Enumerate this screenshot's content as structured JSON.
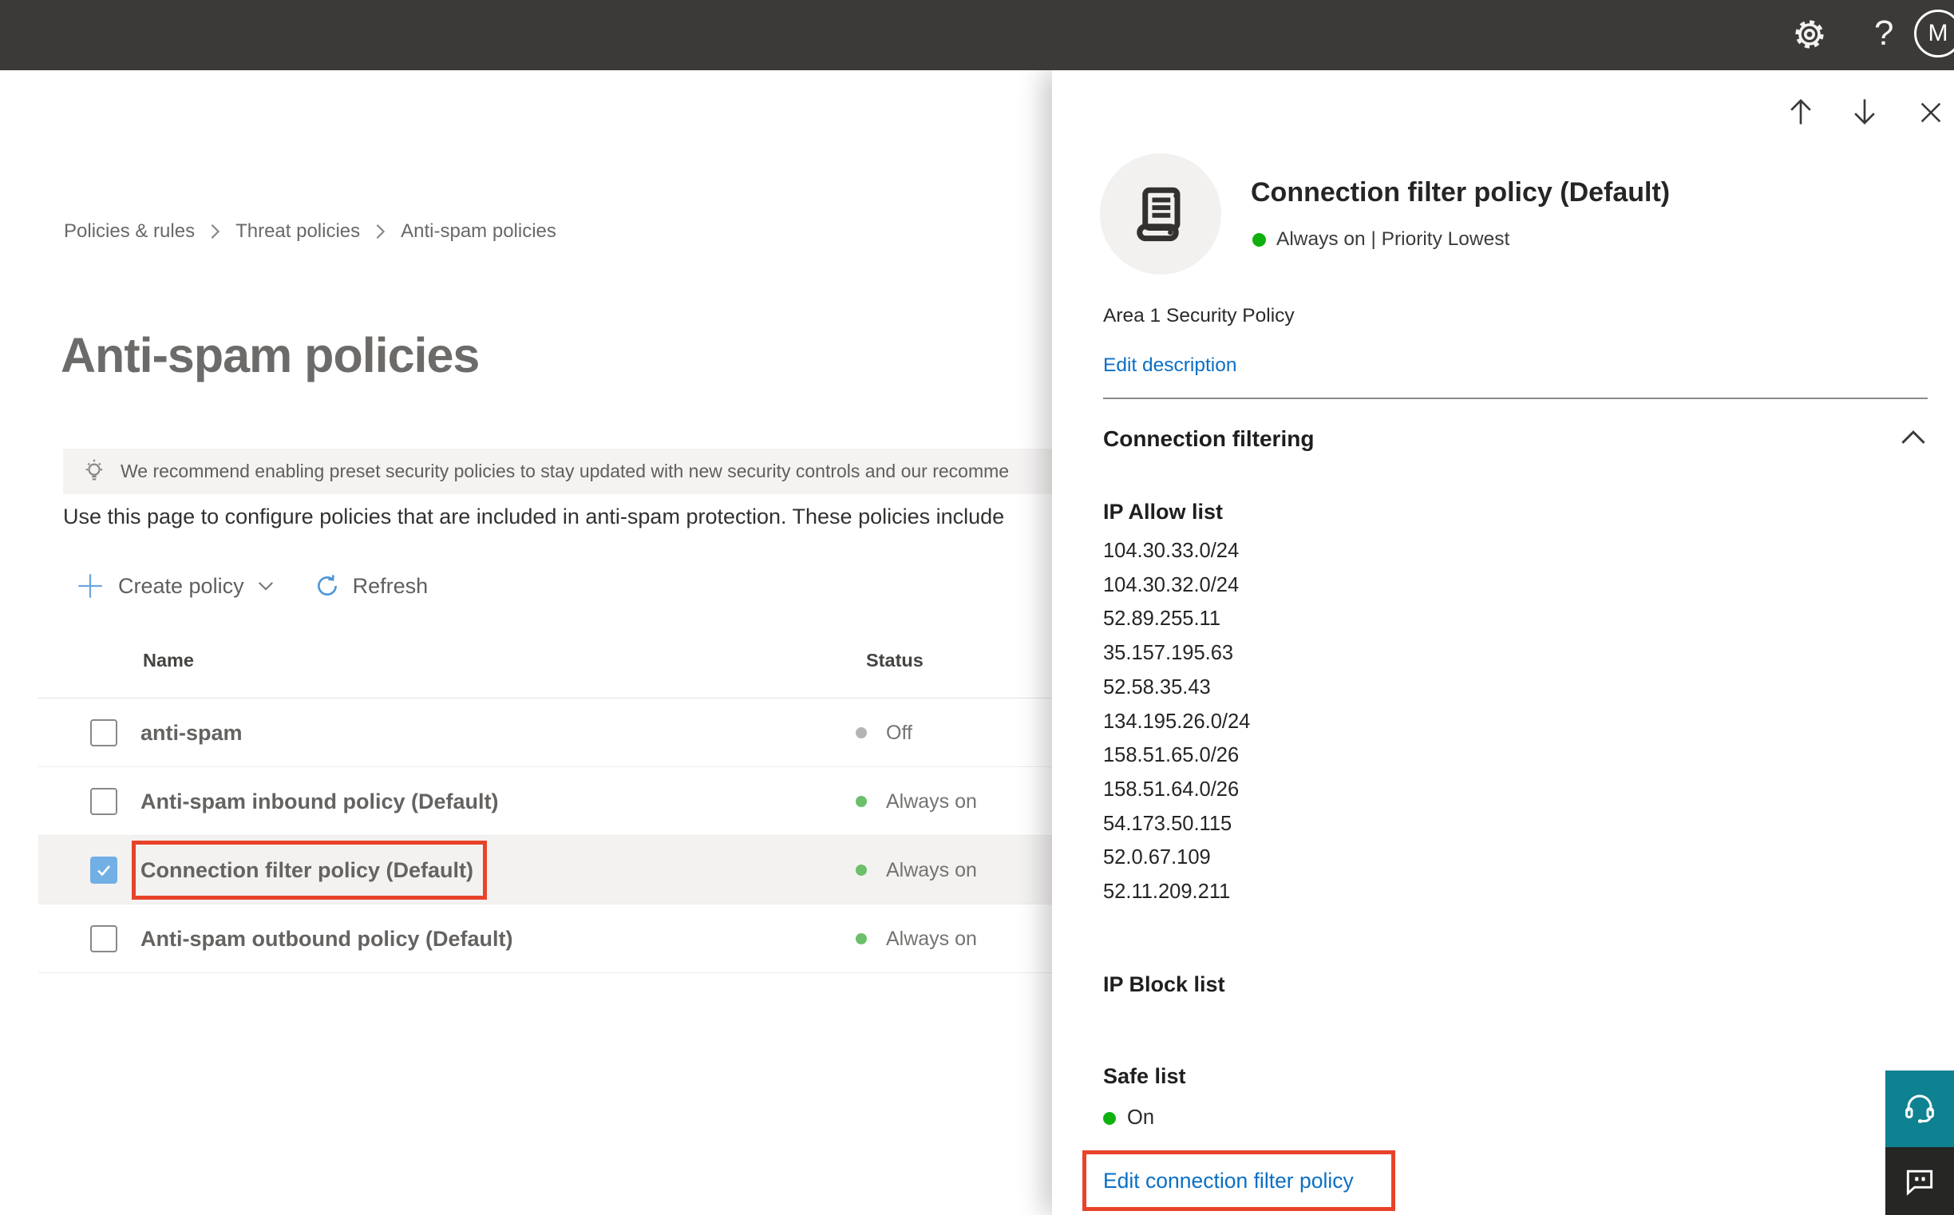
{
  "topbar": {
    "help_label": "?",
    "avatar_initial": "M"
  },
  "breadcrumb": {
    "items": [
      "Policies & rules",
      "Threat policies",
      "Anti-spam policies"
    ]
  },
  "main": {
    "title": "Anti-spam policies",
    "banner_text": "We recommend enabling preset security policies to stay updated with new security controls and our recomme",
    "description": "Use this page to configure policies that are included in anti-spam protection. These policies include",
    "toolbar": {
      "create_policy_label": "Create policy",
      "refresh_label": "Refresh"
    }
  },
  "table": {
    "columns": {
      "name": "Name",
      "status": "Status"
    },
    "rows": [
      {
        "name": "anti-spam",
        "status": "Off",
        "checked": false,
        "selected": false
      },
      {
        "name": "Anti-spam inbound policy (Default)",
        "status": "Always on",
        "checked": false,
        "selected": false
      },
      {
        "name": "Connection filter policy (Default)",
        "status": "Always on",
        "checked": true,
        "selected": true
      },
      {
        "name": "Anti-spam outbound policy (Default)",
        "status": "Always on",
        "checked": false,
        "selected": false
      }
    ]
  },
  "panel": {
    "title": "Connection filter policy (Default)",
    "status_line": "Always on | Priority Lowest",
    "description": "Area 1 Security Policy",
    "edit_description_label": "Edit description",
    "section_title": "Connection filtering",
    "ip_allow": {
      "heading": "IP Allow list",
      "ips": [
        "104.30.33.0/24",
        "104.30.32.0/24",
        "52.89.255.11",
        "35.157.195.63",
        "52.58.35.43",
        "134.195.26.0/24",
        "158.51.65.0/26",
        "158.51.64.0/26",
        "54.173.50.115",
        "52.0.67.109",
        "52.11.209.211"
      ]
    },
    "ip_block": {
      "heading": "IP Block list"
    },
    "safe_list": {
      "heading": "Safe list",
      "status": "On"
    },
    "edit_link_label": "Edit connection filter policy"
  },
  "colors": {
    "link_blue": "#0b6fc4",
    "annotation_red": "#e8432a",
    "status_on_green": "#6cbf6b",
    "status_off_gray": "#b6b4b2",
    "panel_green": "#0fb00f",
    "checkbox_blue": "#71afe5",
    "support_teal": "#0f8291",
    "topbar_dark": "#3b3a39"
  }
}
